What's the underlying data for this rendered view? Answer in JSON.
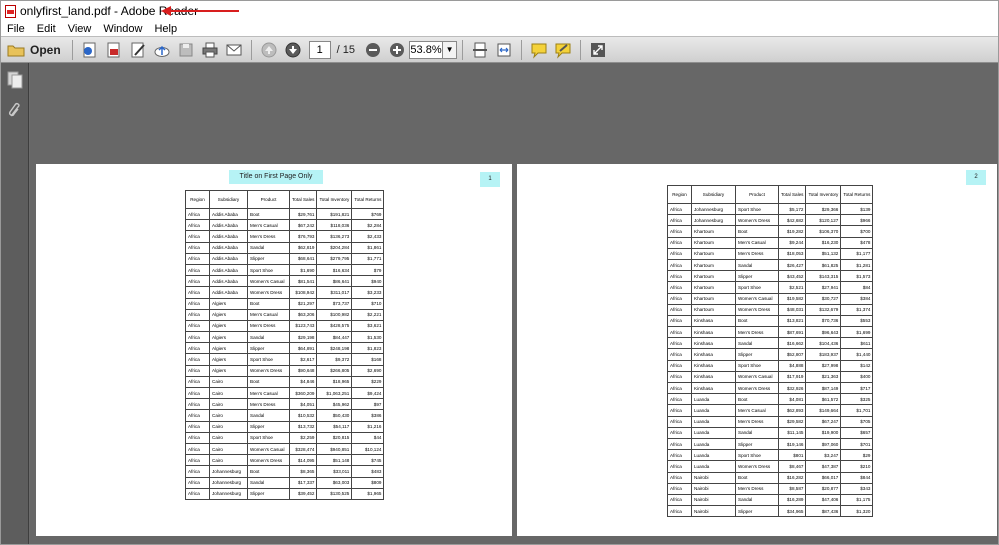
{
  "window": {
    "title": "onlyfirst_land.pdf - Adobe Reader"
  },
  "menu": [
    "File",
    "Edit",
    "View",
    "Window",
    "Help"
  ],
  "toolbar": {
    "open_label": "Open",
    "page_current": "1",
    "page_total": "/ 15",
    "zoom": "53.8%"
  },
  "pages": [
    {
      "number": "1",
      "title": "Title on First Page Only",
      "headers": [
        "Region",
        "Subsidiary",
        "Product",
        "Total Sales",
        "Total Inventory",
        "Total Returns"
      ],
      "rows": [
        [
          "Africa",
          "Addis Ababa",
          "Boot",
          "$29,761",
          "$191,821",
          "$769"
        ],
        [
          "Africa",
          "Addis Ababa",
          "Men's Casual",
          "$67,242",
          "$118,036",
          "$2,284"
        ],
        [
          "Africa",
          "Addis Ababa",
          "Men's Dress",
          "$76,793",
          "$136,273",
          "$2,433"
        ],
        [
          "Africa",
          "Addis Ababa",
          "Sandal",
          "$62,819",
          "$204,284",
          "$1,861"
        ],
        [
          "Africa",
          "Addis Ababa",
          "Slipper",
          "$68,641",
          "$279,795",
          "$1,771"
        ],
        [
          "Africa",
          "Addis Ababa",
          "Sport Shoe",
          "$1,690",
          "$16,634",
          "$79"
        ],
        [
          "Africa",
          "Addis Ababa",
          "Women's Casual",
          "$81,541",
          "$86,641",
          "$940"
        ],
        [
          "Africa",
          "Addis Ababa",
          "Women's Dress",
          "$108,942",
          "$311,017",
          "$3,233"
        ],
        [
          "Africa",
          "Algiers",
          "Boot",
          "$21,297",
          "$73,737",
          "$710"
        ],
        [
          "Africa",
          "Algiers",
          "Men's Casual",
          "$63,206",
          "$100,982",
          "$2,221"
        ],
        [
          "Africa",
          "Algiers",
          "Men's Dress",
          "$123,743",
          "$428,575",
          "$3,621"
        ],
        [
          "Africa",
          "Algiers",
          "Sandal",
          "$29,198",
          "$84,447",
          "$1,530"
        ],
        [
          "Africa",
          "Algiers",
          "Slipper",
          "$64,891",
          "$248,198",
          "$1,823"
        ],
        [
          "Africa",
          "Algiers",
          "Sport Shoe",
          "$2,617",
          "$9,372",
          "$168"
        ],
        [
          "Africa",
          "Algiers",
          "Women's Dress",
          "$90,648",
          "$266,805",
          "$2,690"
        ],
        [
          "Africa",
          "Cairo",
          "Boot",
          "$4,846",
          "$18,965",
          "$229"
        ],
        [
          "Africa",
          "Cairo",
          "Men's Casual",
          "$360,209",
          "$1,063,251",
          "$9,424"
        ],
        [
          "Africa",
          "Cairo",
          "Men's Dress",
          "$4,051",
          "$45,962",
          "$97"
        ],
        [
          "Africa",
          "Cairo",
          "Sandal",
          "$10,532",
          "$50,430",
          "$386"
        ],
        [
          "Africa",
          "Cairo",
          "Slipper",
          "$13,732",
          "$54,117",
          "$1,216"
        ],
        [
          "Africa",
          "Cairo",
          "Sport Shoe",
          "$2,259",
          "$20,815",
          "$44"
        ],
        [
          "Africa",
          "Cairo",
          "Women's Casual",
          "$328,474",
          "$940,851",
          "$10,124"
        ],
        [
          "Africa",
          "Cairo",
          "Women's Dress",
          "$14,095",
          "$51,148",
          "$745"
        ],
        [
          "Africa",
          "Johannesburg",
          "Boot",
          "$8,365",
          "$33,011",
          "$483"
        ],
        [
          "Africa",
          "Johannesburg",
          "Sandal",
          "$17,337",
          "$63,003",
          "$809"
        ],
        [
          "Africa",
          "Johannesburg",
          "Slipper",
          "$39,452",
          "$130,525",
          "$1,965"
        ]
      ]
    },
    {
      "number": "2",
      "headers": [
        "Region",
        "Subsidiary",
        "Product",
        "Total Sales",
        "Total Inventory",
        "Total Returns"
      ],
      "rows": [
        [
          "Africa",
          "Johannesburg",
          "Sport Shoe",
          "$5,172",
          "$29,366",
          "$139"
        ],
        [
          "Africa",
          "Johannesburg",
          "Women's Dress",
          "$42,682",
          "$120,127",
          "$966"
        ],
        [
          "Africa",
          "Khartoum",
          "Boot",
          "$19,282",
          "$106,370",
          "$700"
        ],
        [
          "Africa",
          "Khartoum",
          "Men's Casual",
          "$9,244",
          "$16,230",
          "$478"
        ],
        [
          "Africa",
          "Khartoum",
          "Men's Dress",
          "$18,053",
          "$51,132",
          "$1,177"
        ],
        [
          "Africa",
          "Khartoum",
          "Sandal",
          "$26,427",
          "$61,825",
          "$1,281"
        ],
        [
          "Africa",
          "Khartoum",
          "Slipper",
          "$43,452",
          "$143,315",
          "$1,573"
        ],
        [
          "Africa",
          "Khartoum",
          "Sport Shoe",
          "$2,521",
          "$27,941",
          "$84"
        ],
        [
          "Africa",
          "Khartoum",
          "Women's Casual",
          "$19,582",
          "$30,727",
          "$384"
        ],
        [
          "Africa",
          "Khartoum",
          "Women's Dress",
          "$48,031",
          "$132,679",
          "$1,374"
        ],
        [
          "Africa",
          "Kinshasa",
          "Boot",
          "$13,821",
          "$70,736",
          "$553"
        ],
        [
          "Africa",
          "Kinshasa",
          "Men's Dress",
          "$87,691",
          "$96,643",
          "$1,699"
        ],
        [
          "Africa",
          "Kinshasa",
          "Sandal",
          "$16,662",
          "$104,436",
          "$611"
        ],
        [
          "Africa",
          "Kinshasa",
          "Slipper",
          "$52,807",
          "$183,937",
          "$1,440"
        ],
        [
          "Africa",
          "Kinshasa",
          "Sport Shoe",
          "$4,888",
          "$27,998",
          "$142"
        ],
        [
          "Africa",
          "Kinshasa",
          "Women's Casual",
          "$17,919",
          "$21,363",
          "$400"
        ],
        [
          "Africa",
          "Kinshasa",
          "Women's Dress",
          "$32,926",
          "$87,149",
          "$717"
        ],
        [
          "Africa",
          "Luanda",
          "Boot",
          "$4,081",
          "$61,572",
          "$325"
        ],
        [
          "Africa",
          "Luanda",
          "Men's Casual",
          "$62,893",
          "$149,664",
          "$1,701"
        ],
        [
          "Africa",
          "Luanda",
          "Men's Dress",
          "$29,582",
          "$67,247",
          "$705"
        ],
        [
          "Africa",
          "Luanda",
          "Sandal",
          "$11,145",
          "$19,900",
          "$657"
        ],
        [
          "Africa",
          "Luanda",
          "Slipper",
          "$19,146",
          "$97,060",
          "$701"
        ],
        [
          "Africa",
          "Luanda",
          "Sport Shoe",
          "$801",
          "$3,247",
          "$29"
        ],
        [
          "Africa",
          "Luanda",
          "Women's Dress",
          "$8,467",
          "$47,387",
          "$210"
        ],
        [
          "Africa",
          "Nairobi",
          "Boot",
          "$16,282",
          "$66,017",
          "$844"
        ],
        [
          "Africa",
          "Nairobi",
          "Men's Dress",
          "$8,587",
          "$20,877",
          "$343"
        ],
        [
          "Africa",
          "Nairobi",
          "Sandal",
          "$16,289",
          "$47,406",
          "$1,175"
        ],
        [
          "Africa",
          "Nairobi",
          "Slipper",
          "$34,965",
          "$87,436",
          "$1,320"
        ]
      ]
    }
  ],
  "colors": {
    "highlight": "#b6f3f5",
    "arrow": "#d81e1e",
    "docBackground": "#676767"
  }
}
